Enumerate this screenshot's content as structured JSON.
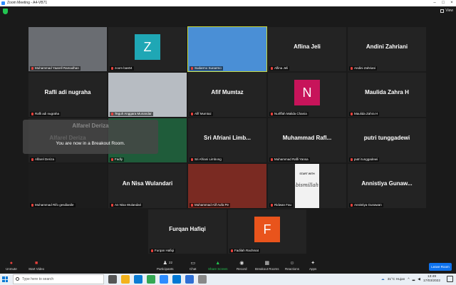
{
  "window": {
    "title": "Zoom Meeting - A4-VB71"
  },
  "header": {
    "view_label": "View"
  },
  "tiles": [
    {
      "kind": "video",
      "name": "Muhammad Yaarell Ramadhan",
      "bg": "#6a6d72"
    },
    {
      "kind": "avatar",
      "name": "zoom bas04",
      "letter": "Z",
      "color": "#1fa7b5"
    },
    {
      "kind": "video",
      "name": "Sudarmo Sunarmo",
      "bg": "#4a8fd6",
      "active": true
    },
    {
      "kind": "name",
      "name": "Aflina Jeli",
      "big": "Aflina Jeli"
    },
    {
      "kind": "name",
      "name": "Andini Zahriani",
      "big": "Andini Zahriani"
    },
    {
      "kind": "name",
      "name": "Rafli adi nugraha",
      "big": "Rafli adi nugraha"
    },
    {
      "kind": "video",
      "name": "Teguh Anggara Munandar",
      "bg": "#b7bcc2"
    },
    {
      "kind": "name",
      "name": "Afif Mumtaz",
      "big": "Afif Mumtaz"
    },
    {
      "kind": "avatar",
      "name": "Nurlffah Malida Chania",
      "letter": "N",
      "color": "#c7145a"
    },
    {
      "kind": "name",
      "name": "Maulida Zahra H",
      "big": "Maulida Zahra H"
    },
    {
      "kind": "name",
      "name": "Alfarel Deriza",
      "big": "Alfarel Deriza"
    },
    {
      "kind": "video",
      "name": "Fadly",
      "bg": "#1f5c3a"
    },
    {
      "kind": "name",
      "name": "Sri Afriani Limbong",
      "big": "Sri  Afriani  Limb..."
    },
    {
      "kind": "name",
      "name": "Muhammad Rafli Yansa",
      "big": "Muhammad  Rafl..."
    },
    {
      "kind": "name",
      "name": "putri tunggadewi",
      "big": "putri tunggadewi"
    },
    {
      "kind": "video",
      "name": "Muhammad Rifo gesdianile",
      "bg": "#1c1c1c"
    },
    {
      "kind": "name",
      "name": "An Nisa Wulandari",
      "big": "An Nisa Wulandari"
    },
    {
      "kind": "video",
      "name": "Muhammad Alif Aufa Pe",
      "bg": "#7a2a22"
    },
    {
      "kind": "video",
      "name": "Ridwan Fau",
      "bg": "#f2f2f2",
      "caption_top": "START WITH",
      "caption": "bismillah"
    },
    {
      "kind": "name",
      "name": "Annistiya Gunawan",
      "big": "Annistiya  Gunaw..."
    },
    {
      "kind": "name",
      "name": "Furqan Hafiqi",
      "big": "Furqan Hafiqi"
    },
    {
      "kind": "avatar",
      "name": "Fadilah Rachmat",
      "letter": "F",
      "color": "#e9541c"
    }
  ],
  "toast": {
    "ghost_name": "Alfarel Deriza",
    "message": "You are now in a Breakout Room."
  },
  "toolbar": {
    "unmute": "Unmute",
    "start_video": "Start Video",
    "participants": "Participants",
    "participants_count": "22",
    "chat": "Chat",
    "share_screen": "Share Screen",
    "record": "Record",
    "breakout_rooms": "Breakout Rooms",
    "reactions": "Reactions",
    "apps": "Apps",
    "leave": "Leave Room"
  },
  "taskbar": {
    "search_placeholder": "Type here to search",
    "weather": "31°C  Hujan",
    "time": "13:49",
    "date": "17/03/2022"
  },
  "colors": {
    "accent": "#0e72ed",
    "active_speaker": "#c8d83a",
    "share_green": "#23c552"
  }
}
